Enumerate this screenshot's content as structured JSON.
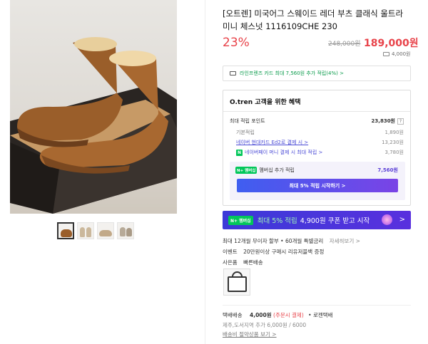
{
  "product": {
    "title": "[오트렌] 미국어그 스웨이드 레더 부츠 클래식 울트라 미니 체스넛 1116109CHE 230",
    "discount": "23%",
    "original_price": "248,000원",
    "price": "189,000원",
    "shipping_badge": "4,000원"
  },
  "card_banner": "라인프렌즈 카드 최대 7,560원 추가 적립(4%) >",
  "benefits": {
    "title": "O.tren 고객을 위한 혜택",
    "max_points_label": "최대 적립 포인트",
    "max_points_value": "23,830원",
    "basic_label": "기본적립",
    "basic_value": "1,890원",
    "hyundai_label": "네이버 현대카드 Ed2로 결제 시 >",
    "hyundai_value": "13,230원",
    "npay_label": "네이버페이 머니 결제 시 최대 적립 >",
    "npay_value": "3,780원",
    "member_label": "멤버십 추가 적립",
    "member_value": "7,560원",
    "member_button": "최대 5% 적립 시작하기 >",
    "nplus_badge": "N+",
    "nplus_tiny": "멤버십"
  },
  "coupon": {
    "badge": "N+ 멤버십",
    "highlight": "최대 5% 적립",
    "text": "4,900원 쿠폰 받고 시작",
    "arrow": ">"
  },
  "installment": {
    "text": "최대 12개월 무이자 할부 • 60개월 특별금리",
    "link": "자세히보기 >"
  },
  "event": {
    "label": "이벤트",
    "text": "20만원이상 구매시 리유저블백 증정"
  },
  "gift": {
    "label": "사은품",
    "text": "빠른배송"
  },
  "delivery": {
    "label": "택배배송",
    "fee": "4,000원",
    "prepaid": "(주문시 결제)",
    "courier": "• 로젠택배",
    "extra": "제주,도서지역 추가 6,000원 / 6000",
    "bundle_link": "배송비 절약상품 보기 >"
  },
  "colors": {
    "accent_red": "#e8434a",
    "npay_green": "#03c75a",
    "purple": "#5a3fd6"
  },
  "icons": [
    "card-icon",
    "truck-icon",
    "question-icon",
    "gift-icon",
    "arrow-right-icon"
  ]
}
